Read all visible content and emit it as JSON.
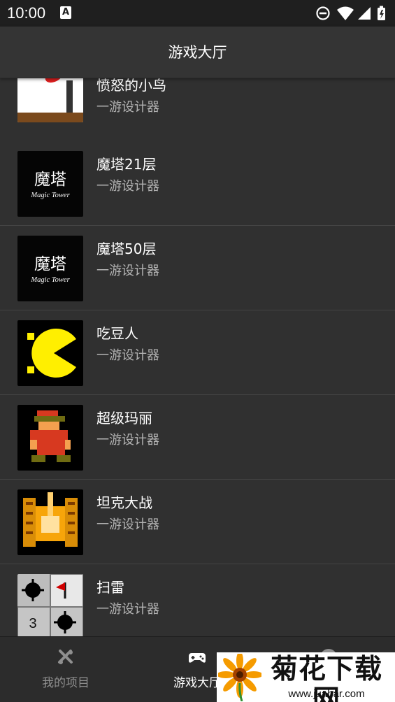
{
  "status_bar": {
    "time": "10:00",
    "a_badge": "A",
    "icons": [
      "do-not-disturb-icon",
      "wifi-icon",
      "signal-icon",
      "battery-icon"
    ]
  },
  "app_bar": {
    "title": "游戏大厅"
  },
  "games": [
    {
      "name": "愤怒的小鸟",
      "author": "一游设计器",
      "thumb_icon": "angry-birds-thumbnail-icon"
    },
    {
      "name": "魔塔21层",
      "author": "一游设计器",
      "thumb_icon": "magic-tower-thumbnail-icon"
    },
    {
      "name": "魔塔50层",
      "author": "一游设计器",
      "thumb_icon": "magic-tower-50-thumbnail-icon"
    },
    {
      "name": "吃豆人",
      "author": "一游设计器",
      "thumb_icon": "pacman-thumbnail-icon"
    },
    {
      "name": "超级玛丽",
      "author": "一游设计器",
      "thumb_icon": "super-mario-thumbnail-icon"
    },
    {
      "name": "坦克大战",
      "author": "一游设计器",
      "thumb_icon": "tank-battle-thumbnail-icon"
    },
    {
      "name": "扫雷",
      "author": "一游设计器",
      "thumb_icon": "minesweeper-thumbnail-icon"
    }
  ],
  "thumb_text": {
    "magic_tower_cn": "魔塔",
    "magic_tower_en": "Magic Tower",
    "minesweeper_number": "3"
  },
  "bottom_nav": {
    "items": [
      {
        "label": "我的项目",
        "icon": "tools-icon",
        "active": false
      },
      {
        "label": "游戏大厅",
        "icon": "gamepad-icon",
        "active": true
      },
      {
        "label": "",
        "icon": "profile-icon",
        "active": false
      }
    ]
  },
  "watermark": {
    "title": "菊花下载网",
    "url": "www.juahar.com"
  },
  "colors": {
    "app_background": "#2f2f2f",
    "status_bar": "#1f1f1f",
    "app_bar": "#343434",
    "bottom_nav": "#2c2c2c",
    "active_label": "#ffffff",
    "inactive_label": "#8f8f8f"
  }
}
